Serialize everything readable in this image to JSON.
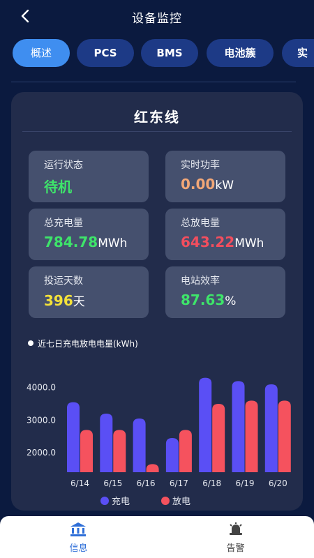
{
  "header": {
    "title": "设备监控"
  },
  "tabs": [
    {
      "label": "概述"
    },
    {
      "label": "PCS"
    },
    {
      "label": "BMS"
    },
    {
      "label": "电池簇"
    },
    {
      "label": "实"
    }
  ],
  "station": {
    "name": "红东线",
    "stats": [
      {
        "label": "运行状态",
        "value": "待机",
        "unit": "",
        "color": "#3ee46a"
      },
      {
        "label": "实时功率",
        "value": "0.00",
        "unit": "kW",
        "color": "#f2a777"
      },
      {
        "label": "总充电量",
        "value": "784.78",
        "unit": "MWh",
        "color": "#3ee46a"
      },
      {
        "label": "总放电量",
        "value": "643.22",
        "unit": "MWh",
        "color": "#f24e5e"
      },
      {
        "label": "投运天数",
        "value": "396",
        "unit": "天",
        "color": "#f4e23a"
      },
      {
        "label": "电站效率",
        "value": "87.63",
        "unit": "%",
        "color": "#3ee46a"
      }
    ]
  },
  "chart_section": {
    "label": "近七日充电放电电量(kWh)"
  },
  "chart_data": {
    "type": "bar",
    "categories": [
      "6/14",
      "6/15",
      "6/16",
      "6/17",
      "6/18",
      "6/19",
      "6/20"
    ],
    "series": [
      {
        "name": "充电",
        "values": [
          3550,
          3200,
          3050,
          2450,
          4300,
          4200,
          4100
        ],
        "color": "#5a4ff5"
      },
      {
        "name": "放电",
        "values": [
          2700,
          2700,
          1650,
          2700,
          3500,
          3600,
          3600
        ],
        "color": "#f5525e"
      }
    ],
    "yticks": [
      "4000.0",
      "3000.0",
      "2000.0"
    ],
    "ylim": [
      1400,
      4400
    ],
    "legend": "bottom"
  },
  "bottom_nav": [
    {
      "label": "信息",
      "icon": "bank-icon",
      "color": "#2f6fd8"
    },
    {
      "label": "告警",
      "icon": "alarm-bell-icon",
      "color": "#444444"
    }
  ]
}
